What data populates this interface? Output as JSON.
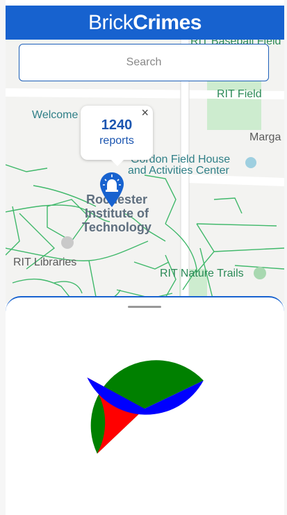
{
  "header": {
    "title_light": "Brick",
    "title_bold": "Crimes"
  },
  "search": {
    "placeholder": "Search"
  },
  "map": {
    "labels": {
      "baseball": "RIT Baseball Field",
      "welcome": "Welcome",
      "field": "RIT Field",
      "marga": "Marga",
      "fieldhouse_1": "Gordon Field House",
      "fieldhouse_2": "and Activities Center",
      "campus_1": "Rochester",
      "campus_2": "Institute of",
      "campus_3": "Technology",
      "libraries": "RIT Libraries",
      "trails": "RIT Nature Trails"
    },
    "popup": {
      "count": "1240",
      "unit": "reports",
      "close": "×"
    },
    "colors": {
      "paths": "#3fb86a",
      "park": "#cdeccf",
      "pin": "#1762cf"
    }
  },
  "chart_data": {
    "type": "pie",
    "values": [
      45,
      20,
      35
    ],
    "colors": [
      "#008000",
      "#ff0000",
      "#0000ff"
    ],
    "start_angle_deg": -25.5
  }
}
